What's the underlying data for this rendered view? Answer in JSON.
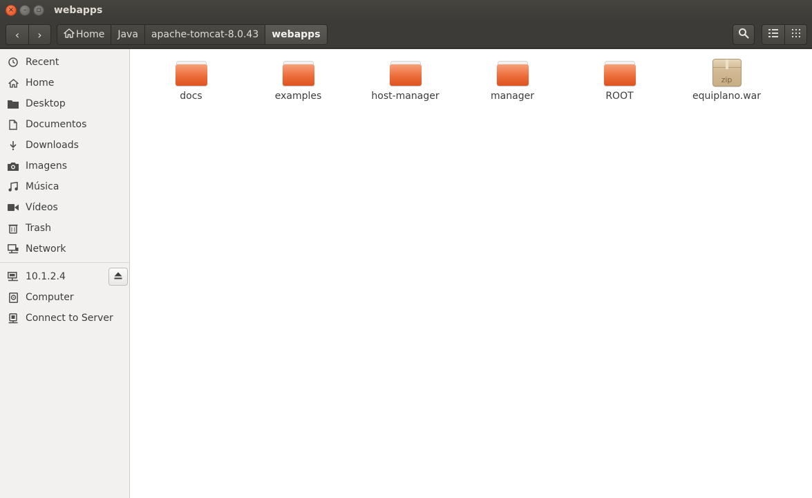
{
  "window": {
    "title": "webapps",
    "close_glyph": "×",
    "min_glyph": "–",
    "max_glyph": "▫"
  },
  "toolbar": {
    "back_glyph": "‹",
    "forward_glyph": "›",
    "breadcrumbs": [
      {
        "label": "Home",
        "icon": "home-icon"
      },
      {
        "label": "Java"
      },
      {
        "label": "apache-tomcat-8.0.43"
      },
      {
        "label": "webapps",
        "active": true
      }
    ]
  },
  "sidebar": {
    "places": [
      {
        "label": "Recent",
        "icon": "clock-icon"
      },
      {
        "label": "Home",
        "icon": "home-icon"
      },
      {
        "label": "Desktop",
        "icon": "folder-icon"
      },
      {
        "label": "Documentos",
        "icon": "document-icon"
      },
      {
        "label": "Downloads",
        "icon": "download-icon"
      },
      {
        "label": "Imagens",
        "icon": "camera-icon"
      },
      {
        "label": "Música",
        "icon": "music-icon"
      },
      {
        "label": "Vídeos",
        "icon": "video-icon"
      },
      {
        "label": "Trash",
        "icon": "trash-icon"
      },
      {
        "label": "Network",
        "icon": "network-icon"
      }
    ],
    "devices": [
      {
        "label": "10.1.2.4",
        "icon": "network-drive-icon",
        "ejectable": true
      },
      {
        "label": "Computer",
        "icon": "computer-icon"
      },
      {
        "label": "Connect to Server",
        "icon": "server-icon"
      }
    ]
  },
  "files": [
    {
      "name": "docs",
      "type": "folder"
    },
    {
      "name": "examples",
      "type": "folder"
    },
    {
      "name": "host-manager",
      "type": "folder"
    },
    {
      "name": "manager",
      "type": "folder"
    },
    {
      "name": "ROOT",
      "type": "folder"
    },
    {
      "name": "equiplano.war",
      "type": "archive",
      "badge": "zip"
    }
  ],
  "colors": {
    "folder": "#ec6d3a",
    "titlebar": "#3c3b37",
    "close_button": "#e2471b"
  }
}
